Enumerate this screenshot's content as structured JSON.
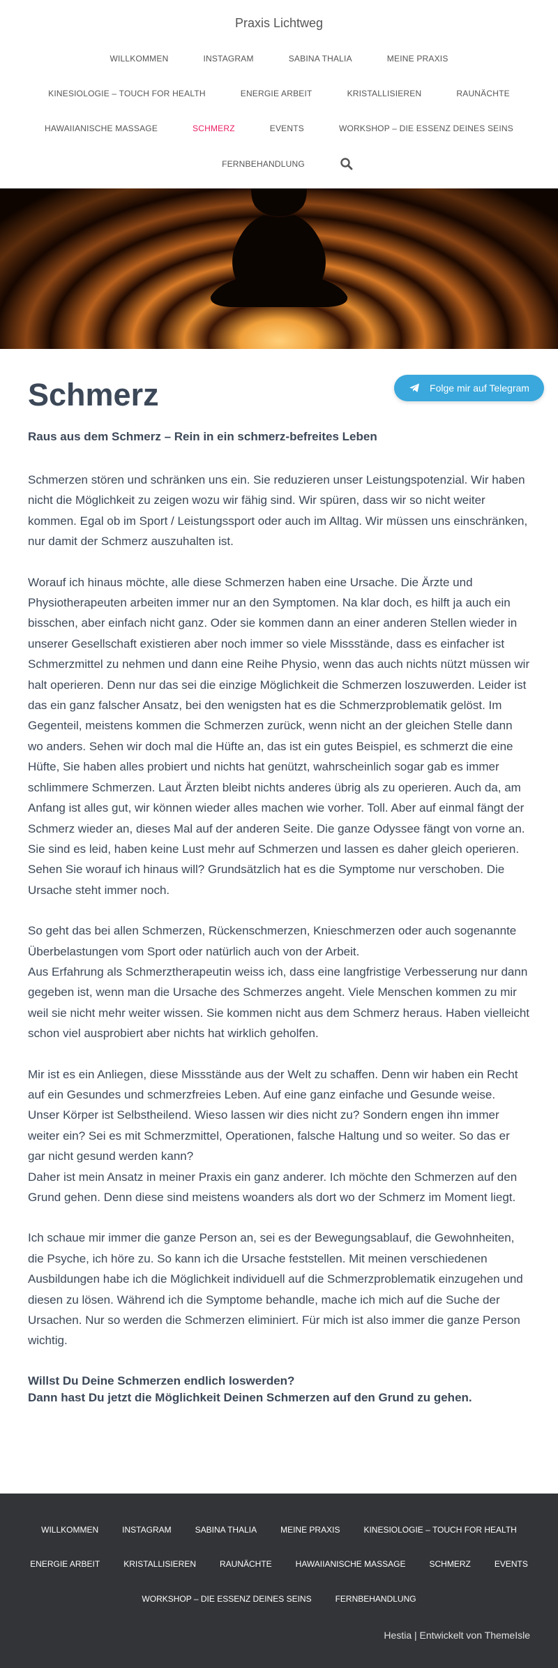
{
  "site": {
    "brand": "Praxis Lichtweg"
  },
  "nav": {
    "items": [
      {
        "label": "WILLKOMMEN"
      },
      {
        "label": "INSTAGRAM"
      },
      {
        "label": "SABINA THALIA"
      },
      {
        "label": "MEINE PRAXIS"
      },
      {
        "label": "KINESIOLOGIE – TOUCH FOR HEALTH"
      },
      {
        "label": "ENERGIE ARBEIT"
      },
      {
        "label": "KRISTALLISIEREN"
      },
      {
        "label": "RAUNÄCHTE"
      },
      {
        "label": "HAWAIIANISCHE MASSAGE"
      },
      {
        "label": "SCHMERZ",
        "active": true
      },
      {
        "label": "EVENTS"
      },
      {
        "label": "WORKSHOP – DIE ESSENZ DEINES SEINS"
      },
      {
        "label": "FERNBEHANDLUNG"
      }
    ],
    "search_icon": "search-icon",
    "active_color": "#e91e63"
  },
  "telegram": {
    "label": "Folge mir auf Telegram",
    "icon": "telegram-paper-plane-icon",
    "color": "#3aa8dc"
  },
  "page": {
    "title": "Schmerz",
    "subtitle": "Raus aus dem Schmerz – Rein in ein schmerz-befreites Leben",
    "paragraphs": [
      "Schmerzen stören und schränken uns ein. Sie reduzieren unser Leistungspotenzial. Wir haben nicht die Möglichkeit zu zeigen wozu wir fähig sind. Wir spüren, dass wir so nicht weiter kommen. Egal ob im Sport / Leistungssport oder auch im Alltag. Wir müssen uns einschränken, nur damit der Schmerz auszuhalten ist.",
      "Worauf ich hinaus möchte, alle diese Schmerzen haben eine Ursache. Die Ärzte und Physiotherapeuten arbeiten immer nur an den Symptomen. Na klar doch, es hilft ja auch ein bisschen, aber einfach nicht ganz. Oder sie kommen dann an einer anderen Stellen wieder in unserer Gesellschaft existieren aber noch immer so viele Missstände, dass es einfacher ist Schmerzmittel zu nehmen und dann eine Reihe Physio, wenn das auch nichts nützt müssen wir halt operieren. Denn nur das sei die einzige Möglichkeit die Schmerzen loszuwerden. Leider ist das ein ganz falscher Ansatz, bei den wenigsten hat es die Schmerzproblematik gelöst. Im Gegenteil, meistens kommen die Schmerzen zurück, wenn nicht an der gleichen Stelle dann wo anders. Sehen wir doch mal die Hüfte an, das ist ein gutes Beispiel, es schmerzt die eine Hüfte, Sie haben alles probiert und nichts hat genützt, wahrscheinlich sogar gab es immer schlimmere Schmerzen. Laut Ärzten bleibt nichts anderes übrig als zu operieren. Auch da, am Anfang ist alles gut, wir können wieder alles machen wie vorher. Toll. Aber auf einmal fängt der Schmerz wieder an, dieses Mal auf der anderen Seite. Die ganze Odyssee fängt von vorne an. Sie sind es leid, haben keine Lust mehr auf Schmerzen und lassen es daher gleich operieren. Sehen Sie worauf ich hinaus will? Grundsätzlich hat es die Symptome nur verschoben. Die Ursache steht immer noch.",
      "So geht das bei allen Schmerzen, Rückenschmerzen, Knieschmerzen oder auch sogenannte Überbelastungen vom Sport oder natürlich auch von der Arbeit.\nAus Erfahrung als Schmerztherapeutin weiss ich, dass eine langfristige Verbesserung nur dann gegeben ist, wenn man die Ursache des Schmerzes angeht. Viele Menschen kommen zu mir weil sie nicht mehr weiter wissen. Sie kommen nicht aus dem Schmerz heraus. Haben vielleicht schon viel ausprobiert aber nichts hat wirklich geholfen.",
      "Mir ist es ein Anliegen, diese Missstände aus der Welt zu schaffen. Denn wir haben ein Recht auf ein Gesundes und schmerzfreies Leben. Auf eine ganz einfache und Gesunde weise. Unser Körper ist Selbstheilend. Wieso lassen wir dies nicht zu? Sondern engen ihn immer weiter ein? Sei es mit Schmerzmittel, Operationen, falsche Haltung und so weiter. So das er gar nicht gesund werden kann?\nDaher ist mein Ansatz in meiner Praxis ein ganz anderer. Ich möchte den Schmerzen auf den Grund gehen. Denn diese sind meistens woanders als dort wo der Schmerz im Moment liegt.",
      "Ich schaue mir immer die ganze Person an, sei es der Bewegungsablauf, die Gewohnheiten, die Psyche, ich höre zu. So kann ich die Ursache feststellen. Mit meinen verschiedenen Ausbildungen habe ich die Möglichkeit individuell auf die Schmerzproblematik einzugehen und diesen zu lösen. Während ich die Symptome behandle, mache ich mich auf die Suche der Ursachen. Nur so werden die Schmerzen eliminiert. Für mich ist also immer die ganze Person wichtig."
    ],
    "cta_line1": "Willst Du Deine Schmerzen endlich loswerden?",
    "cta_line2": "Dann hast Du jetzt die Möglichkeit Deinen Schmerzen auf den Grund zu gehen."
  },
  "footer": {
    "items": [
      {
        "label": "WILLKOMMEN"
      },
      {
        "label": "INSTAGRAM"
      },
      {
        "label": "SABINA THALIA"
      },
      {
        "label": "MEINE PRAXIS"
      },
      {
        "label": "KINESIOLOGIE – TOUCH FOR HEALTH"
      },
      {
        "label": "ENERGIE ARBEIT"
      },
      {
        "label": "KRISTALLISIEREN"
      },
      {
        "label": "RAUNÄCHTE"
      },
      {
        "label": "HAWAIIANISCHE MASSAGE"
      },
      {
        "label": "SCHMERZ"
      },
      {
        "label": "EVENTS"
      },
      {
        "label": "WORKSHOP – DIE ESSENZ DEINES SEINS"
      },
      {
        "label": "FERNBEHANDLUNG"
      }
    ],
    "credit_prefix": "Hestia | Entwickelt von ",
    "credit_link": "ThemeIsle",
    "background": "#323437"
  }
}
